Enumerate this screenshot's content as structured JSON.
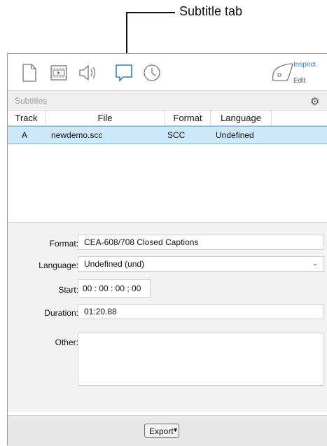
{
  "callout": {
    "label": "Subtitle tab"
  },
  "toolbar": {
    "icons": [
      "document-icon",
      "movie-icon",
      "audio-icon",
      "subtitle-icon",
      "clock-icon"
    ],
    "inspect_label": "Inspect",
    "edit_label": "Edit",
    "active_color": "#2a7fd9"
  },
  "section": {
    "title": "Subtitles"
  },
  "table": {
    "columns": [
      "Track",
      "File",
      "Format",
      "Language"
    ],
    "rows": [
      {
        "track": "A",
        "file": "newdemo.scc",
        "format": "SCC",
        "language": "Undefined"
      }
    ]
  },
  "form": {
    "format_label": "Format:",
    "format_value": "CEA-608/708 Closed Captions",
    "language_label": "Language:",
    "language_value": "Undefined (und)",
    "start_label": "Start:",
    "start_value": "00 : 00 : 00 ; 00",
    "duration_label": "Duration:",
    "duration_value": "01:20.88",
    "other_label": "Other:",
    "other_value": ""
  },
  "bottom": {
    "export_label": "Export"
  }
}
